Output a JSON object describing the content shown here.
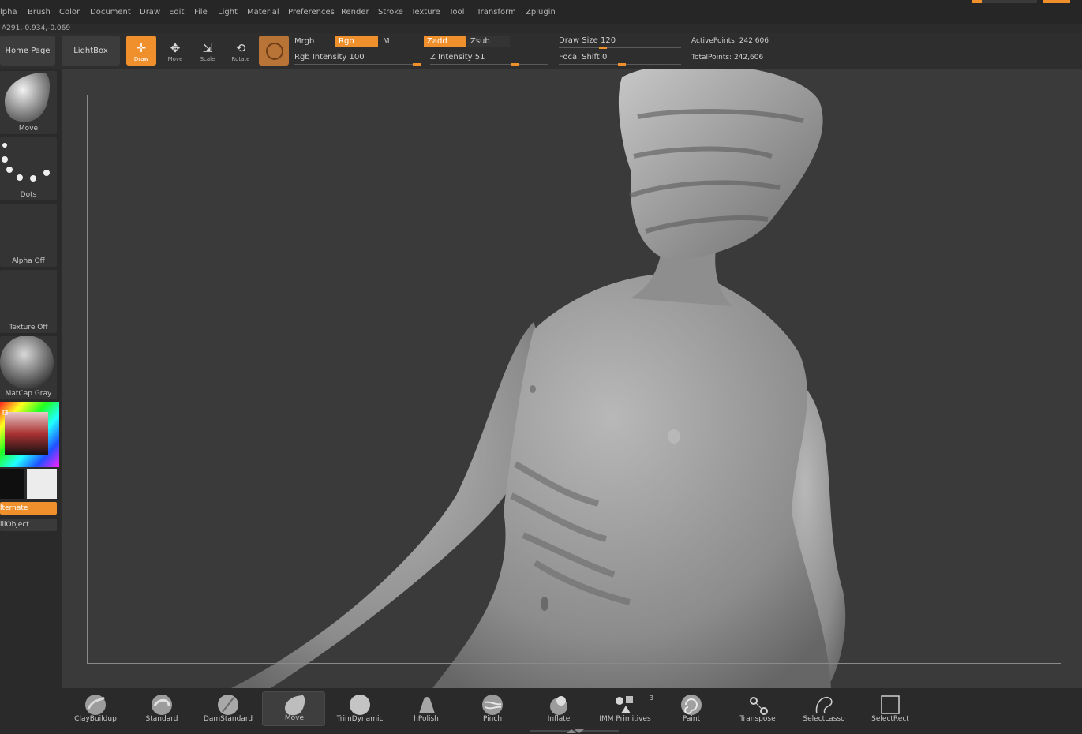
{
  "menu": [
    "lpha",
    "Brush",
    "Color",
    "Document",
    "Draw",
    "Edit",
    "File",
    "Light",
    "Material",
    "Preferences",
    "Render",
    "Stroke",
    "Texture",
    "Tool",
    "Transform",
    "Zplugin"
  ],
  "coords": "A291,-0.934,-0.069",
  "toolbar": {
    "home": "Home Page",
    "lightbox": "LightBox",
    "tools": [
      {
        "name": "draw",
        "label": "Draw",
        "active": true
      },
      {
        "name": "move",
        "label": "Move",
        "active": false
      },
      {
        "name": "scale",
        "label": "Scale",
        "active": false
      },
      {
        "name": "rotate",
        "label": "Rotate",
        "active": false
      }
    ],
    "mrgb": "Mrgb",
    "rgb": "Rgb",
    "m": "M",
    "zadd": "Zadd",
    "zsub": "Zsub",
    "rgb_intensity": "Rgb Intensity 100",
    "z_intensity": "Z Intensity 51",
    "draw_size": "Draw Size 120",
    "focal_shift": "Focal Shift 0",
    "active_points": "ActivePoints: 242,606",
    "total_points": "TotalPoints: 242,606"
  },
  "left": {
    "brush": "Move",
    "stroke": "Dots",
    "alpha": "Alpha Off",
    "texture": "Texture Off",
    "material": "MatCap Gray",
    "alternate": "lternate",
    "fillobject": "illObject"
  },
  "shelf": {
    "brushes": [
      "ClayBuildup",
      "Standard",
      "DamStandard",
      "Move",
      "TrimDynamic",
      "hPolish",
      "Pinch",
      "Inflate",
      "IMM Primitives",
      "Paint",
      "Transpose",
      "SelectLasso",
      "SelectRect"
    ],
    "selected": "Move",
    "imm_badge": "3"
  },
  "colors": {
    "accent": "#f0902d",
    "background": "#2b2b2b",
    "viewport": "#3a3a3a",
    "model": "#9a9a9a"
  }
}
